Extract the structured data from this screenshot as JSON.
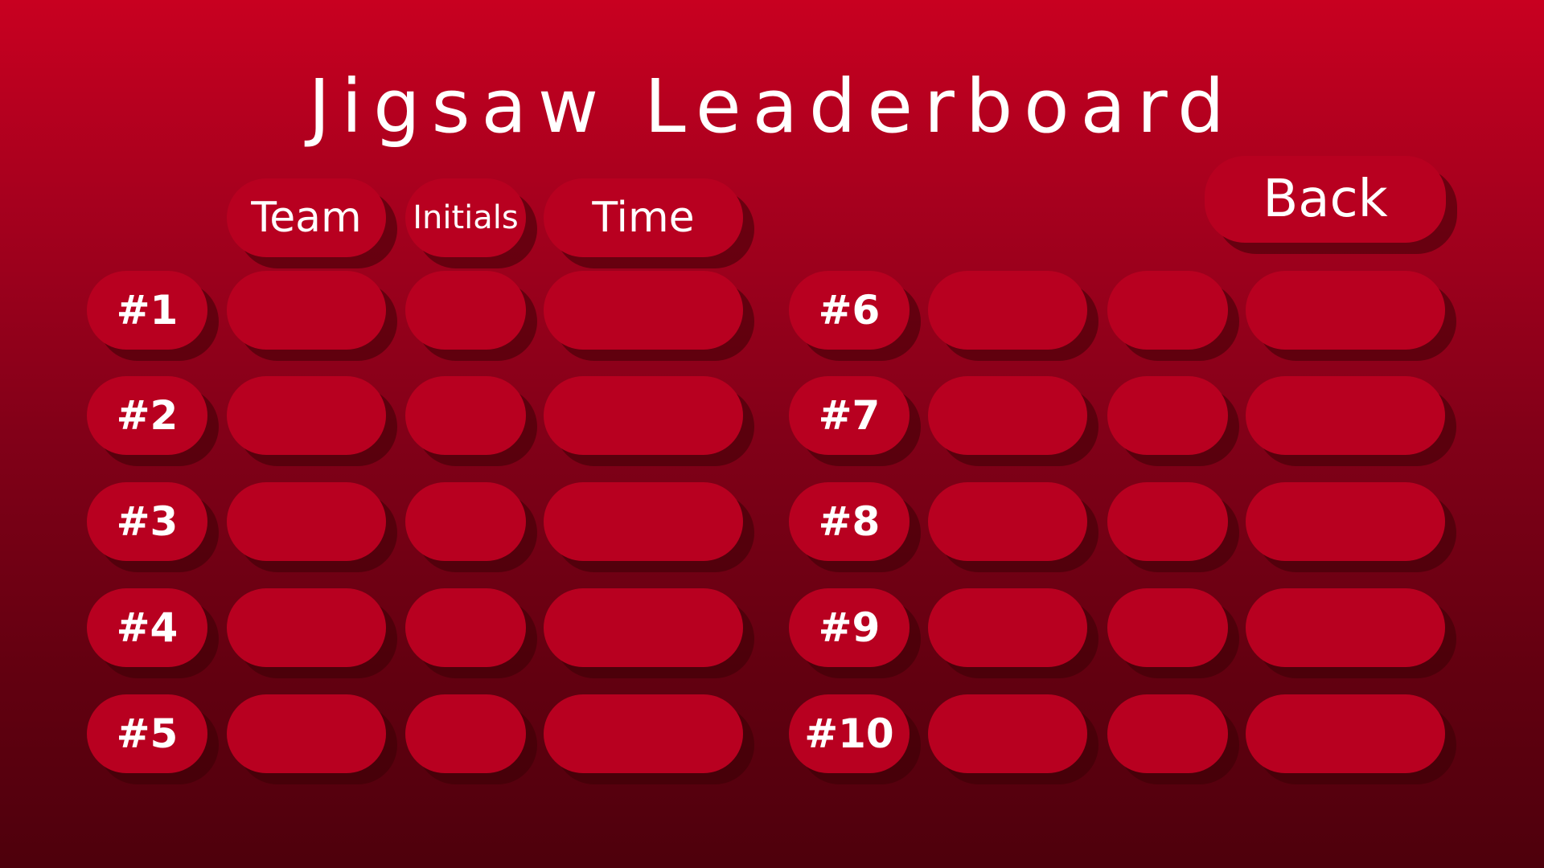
{
  "title": "Jigsaw Leaderboard",
  "headers": {
    "team": "Team",
    "initials": "Initials",
    "time": "Time"
  },
  "back_label": "Back",
  "colors": {
    "pill": "#b80020",
    "text": "#ffffff",
    "background_top": "#c80020",
    "background_bottom": "#4e000c"
  },
  "entries": [
    {
      "rank": "#1",
      "team": "",
      "initials": "",
      "time": ""
    },
    {
      "rank": "#2",
      "team": "",
      "initials": "",
      "time": ""
    },
    {
      "rank": "#3",
      "team": "",
      "initials": "",
      "time": ""
    },
    {
      "rank": "#4",
      "team": "",
      "initials": "",
      "time": ""
    },
    {
      "rank": "#5",
      "team": "",
      "initials": "",
      "time": ""
    },
    {
      "rank": "#6",
      "team": "",
      "initials": "",
      "time": ""
    },
    {
      "rank": "#7",
      "team": "",
      "initials": "",
      "time": ""
    },
    {
      "rank": "#8",
      "team": "",
      "initials": "",
      "time": ""
    },
    {
      "rank": "#9",
      "team": "",
      "initials": "",
      "time": ""
    },
    {
      "rank": "#10",
      "team": "",
      "initials": "",
      "time": ""
    }
  ]
}
